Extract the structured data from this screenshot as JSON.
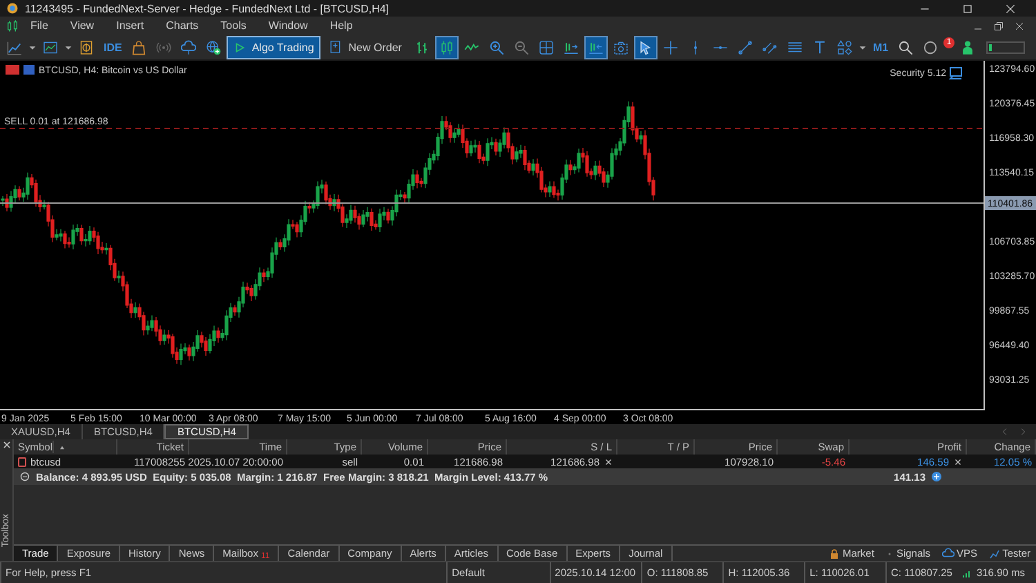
{
  "window": {
    "title": "11243495 - FundedNext-Server - Hedge - FundedNext Ltd - [BTCUSD,H4]"
  },
  "menu": [
    "File",
    "View",
    "Insert",
    "Charts",
    "Tools",
    "Window",
    "Help"
  ],
  "toolbar": [
    {
      "kind": "tool",
      "active": false
    },
    {
      "kind": "tool",
      "active": false
    },
    {
      "kind": "tool",
      "active": false
    },
    {
      "kind": "text",
      "label": "IDE",
      "active": false
    },
    {
      "kind": "tool",
      "active": false
    },
    {
      "kind": "tool",
      "active": false
    },
    {
      "kind": "tool",
      "active": false
    },
    {
      "kind": "tool",
      "active": false
    },
    {
      "kind": "button",
      "label": "Algo Trading",
      "active": true
    },
    {
      "kind": "button",
      "label": "New Order",
      "active": false
    },
    {
      "kind": "tool",
      "active": false
    },
    {
      "kind": "tool",
      "active": true
    },
    {
      "kind": "tool",
      "active": false
    },
    {
      "kind": "tool",
      "active": false
    },
    {
      "kind": "tool",
      "active": false
    },
    {
      "kind": "tool",
      "active": false
    },
    {
      "kind": "tool",
      "active": false
    },
    {
      "kind": "tool",
      "active": true
    },
    {
      "kind": "tool",
      "active": false
    },
    {
      "kind": "tool",
      "active": true
    },
    {
      "kind": "tool",
      "active": false
    },
    {
      "kind": "tool",
      "active": false
    },
    {
      "kind": "tool",
      "active": false
    },
    {
      "kind": "tool",
      "active": false
    },
    {
      "kind": "tool",
      "active": false
    },
    {
      "kind": "tool",
      "active": false
    },
    {
      "kind": "tool",
      "active": false
    },
    {
      "kind": "tool",
      "active": false
    },
    {
      "kind": "text",
      "label": "M1",
      "active": false
    },
    {
      "kind": "tool",
      "active": false
    },
    {
      "kind": "tool",
      "active": false,
      "badge": "1"
    },
    {
      "kind": "tool",
      "active": false
    }
  ],
  "chart": {
    "caption": "BTCUSD, H4: Bitcoin vs US Dollar",
    "security": "Security 5.12",
    "order_line": "SELL 0.01 at 121686.98",
    "price_labels": [
      "123794.60",
      "120376.45",
      "116958.30",
      "113540.15",
      "106703.85",
      "103285.70",
      "99867.55",
      "96449.40",
      "93031.25"
    ],
    "current_price": "110401.86",
    "time_labels": [
      "9 Jan 2025",
      "5 Feb 15:00",
      "10 Mar 00:00",
      "3 Apr 08:00",
      "7 May 15:00",
      "5 Jun 00:00",
      "7 Jul 08:00",
      "5 Aug 16:00",
      "4 Sep 00:00",
      "3 Oct 08:00"
    ]
  },
  "chart_tabs": [
    {
      "label": "XAUUSD,H4",
      "selected": false
    },
    {
      "label": "BTCUSD,H4",
      "selected": false
    },
    {
      "label": "BTCUSD,H4",
      "selected": true
    }
  ],
  "toolbox": {
    "title": "Toolbox",
    "columns": [
      "Symbol",
      "Ticket",
      "Time",
      "Type",
      "Volume",
      "Price",
      "S / L",
      "T / P",
      "Price",
      "Swap",
      "Profit",
      "Change"
    ],
    "positions": [
      {
        "symbol": "btcusd",
        "ticket": "117008255",
        "time": "2025.10.07 20:00:00",
        "type": "sell",
        "volume": "0.01",
        "open_price": "121686.98",
        "sl": "121686.98",
        "price": "107928.10",
        "swap": "-5.46",
        "profit": "146.59",
        "change": "12.05 %"
      }
    ],
    "summary": {
      "text": "Balance: 4 893.95 USD  Equity: 5 035.08  Margin: 1 216.87  Free Margin: 3 818.21  Margin Level: 413.77 %",
      "profit": "141.13"
    },
    "tabs": [
      {
        "label": "Trade",
        "selected": true
      },
      {
        "label": "Exposure",
        "selected": false
      },
      {
        "label": "History",
        "selected": false
      },
      {
        "label": "News",
        "selected": false
      },
      {
        "label": "Mailbox",
        "selected": false,
        "badge": "11"
      },
      {
        "label": "Calendar",
        "selected": false
      },
      {
        "label": "Company",
        "selected": false
      },
      {
        "label": "Alerts",
        "selected": false
      },
      {
        "label": "Articles",
        "selected": false
      },
      {
        "label": "Code Base",
        "selected": false
      },
      {
        "label": "Experts",
        "selected": false
      },
      {
        "label": "Journal",
        "selected": false
      }
    ],
    "services": [
      "Market",
      "Signals",
      "VPS",
      "Tester"
    ]
  },
  "status_bar": {
    "help": "For Help, press F1",
    "profile": "Default",
    "time": "2025.10.14 12:00",
    "open": "O: 111808.85",
    "high": "H: 112005.36",
    "low": "L: 110026.01",
    "close": "C: 110807.25",
    "ping": "316.90 ms"
  }
}
